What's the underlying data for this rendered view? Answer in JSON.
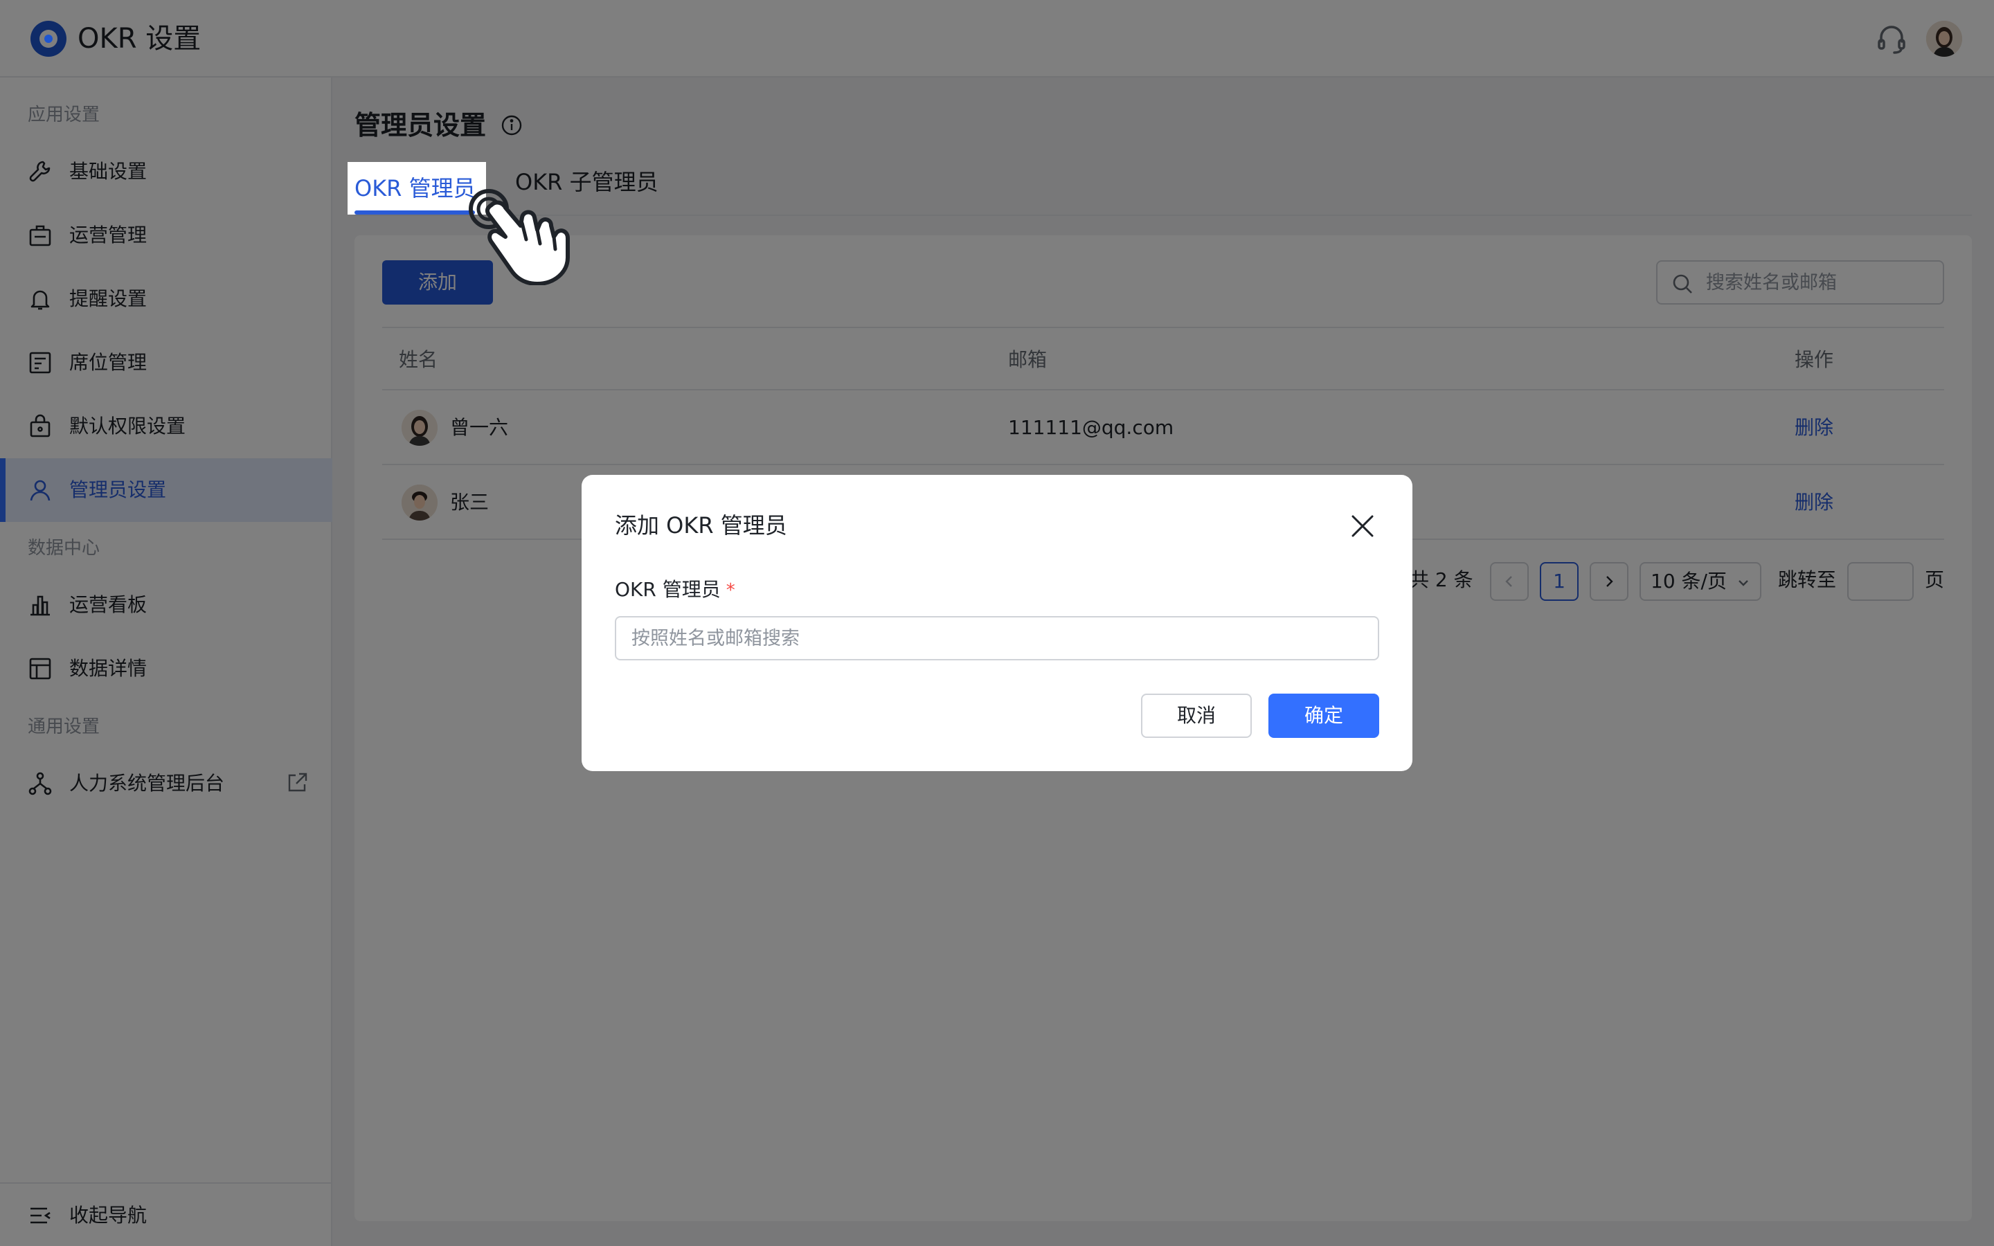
{
  "app": {
    "title": "OKR 设置"
  },
  "sidebar": {
    "sections": [
      {
        "label": "应用设置"
      },
      {
        "label": "数据中心"
      },
      {
        "label": "通用设置"
      }
    ],
    "items": [
      {
        "label": "基础设置",
        "icon": "wrench-icon"
      },
      {
        "label": "运营管理",
        "icon": "briefcase-icon"
      },
      {
        "label": "提醒设置",
        "icon": "bell-icon"
      },
      {
        "label": "席位管理",
        "icon": "seat-icon"
      },
      {
        "label": "默认权限设置",
        "icon": "lock-bag-icon"
      },
      {
        "label": "管理员设置",
        "icon": "user-icon",
        "active": true
      },
      {
        "label": "运营看板",
        "icon": "bar-chart-icon"
      },
      {
        "label": "数据详情",
        "icon": "table-icon"
      },
      {
        "label": "人力系统管理后台",
        "icon": "org-tree-icon"
      }
    ],
    "collapse_label": "收起导航"
  },
  "main": {
    "title": "管理员设置",
    "tabs": [
      {
        "label": "OKR 管理员",
        "active": true
      },
      {
        "label": "OKR 子管理员"
      }
    ],
    "add_label": "添加",
    "search_placeholder": "搜索姓名或邮箱",
    "table": {
      "headers": [
        "姓名",
        "邮箱",
        "操作"
      ],
      "rows": [
        {
          "name": "曾一六",
          "email": "111111@qq.com",
          "action": "删除"
        },
        {
          "name": "张三",
          "email": "",
          "action": "删除"
        }
      ]
    },
    "pagination": {
      "total_text": "共 2 条",
      "current_page": "1",
      "page_size": "10 条/页",
      "jump_label": "跳转至",
      "page_suffix": "页"
    }
  },
  "modal": {
    "title": "添加 OKR 管理员",
    "field_label": "OKR 管理员",
    "required_mark": "*",
    "input_placeholder": "按照姓名或邮箱搜索",
    "cancel_label": "取消",
    "ok_label": "确定"
  },
  "colors": {
    "accent": "#3370ff",
    "link": "#2a5bd7",
    "danger": "#f54a45"
  }
}
